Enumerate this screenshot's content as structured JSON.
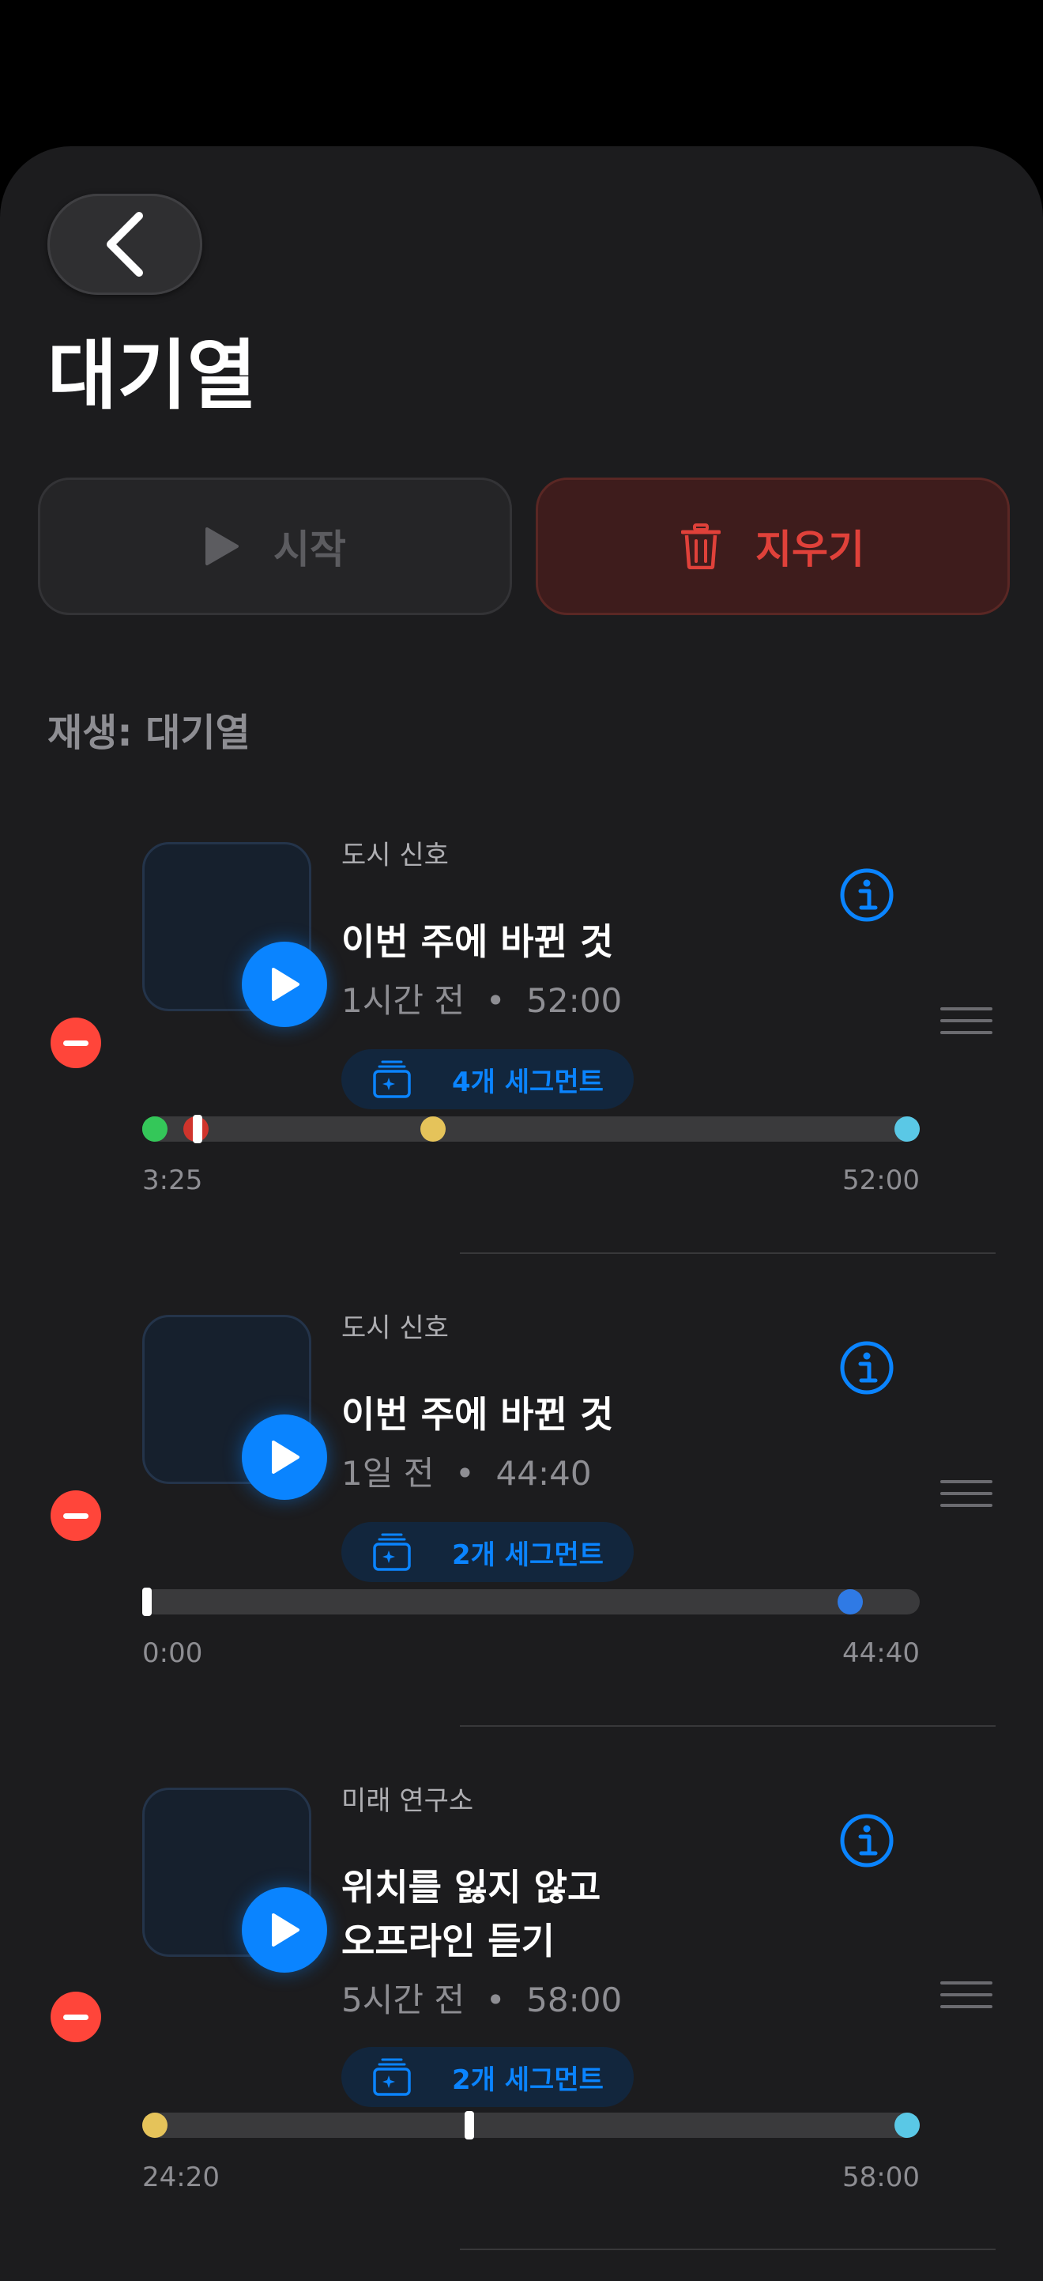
{
  "header": {
    "title": "대기열",
    "back_icon": "chevron-left-icon"
  },
  "actions": {
    "start_label": "시작",
    "clear_label": "지우기"
  },
  "section": {
    "label": "재생: 대기열"
  },
  "colors": {
    "accent": "#0a84ff",
    "danger": "#ff453a",
    "sheet": "#1c1c1e"
  },
  "queue": [
    {
      "podcast": "도시 신호",
      "title": "이번 주에 바뀐 것",
      "meta": "1시간 전  •  52:00",
      "segments": "4개 세그먼트",
      "progress_start": "3:25",
      "progress_end": "52:00",
      "playhead": 0.066,
      "markers": [
        {
          "pos": 0.0,
          "color": "#34c759"
        },
        {
          "pos": 0.055,
          "color": "#d0342c"
        },
        {
          "pos": 0.37,
          "color": "#e5c35a"
        },
        {
          "pos": 1.0,
          "color": "#5ac8e6"
        }
      ]
    },
    {
      "podcast": "도시 신호",
      "title": "이번 주에 바뀐 것",
      "meta": "1일 전  •  44:40",
      "segments": "2개 세그먼트",
      "progress_start": "0:00",
      "progress_end": "44:40",
      "playhead": 0.0,
      "markers": [
        {
          "pos": 0.924,
          "color": "#2f7ae5"
        }
      ]
    },
    {
      "podcast": "미래 연구소",
      "title_line1": "위치를 잃지 않고",
      "title_line2": "오프라인 듣기",
      "meta": "5시간 전  •  58:00",
      "segments": "2개 세그먼트",
      "progress_start": "24:20",
      "progress_end": "58:00",
      "playhead": 0.42,
      "markers": [
        {
          "pos": 0.0,
          "color": "#e5c35a"
        },
        {
          "pos": 1.0,
          "color": "#5ac8e6"
        }
      ]
    }
  ]
}
